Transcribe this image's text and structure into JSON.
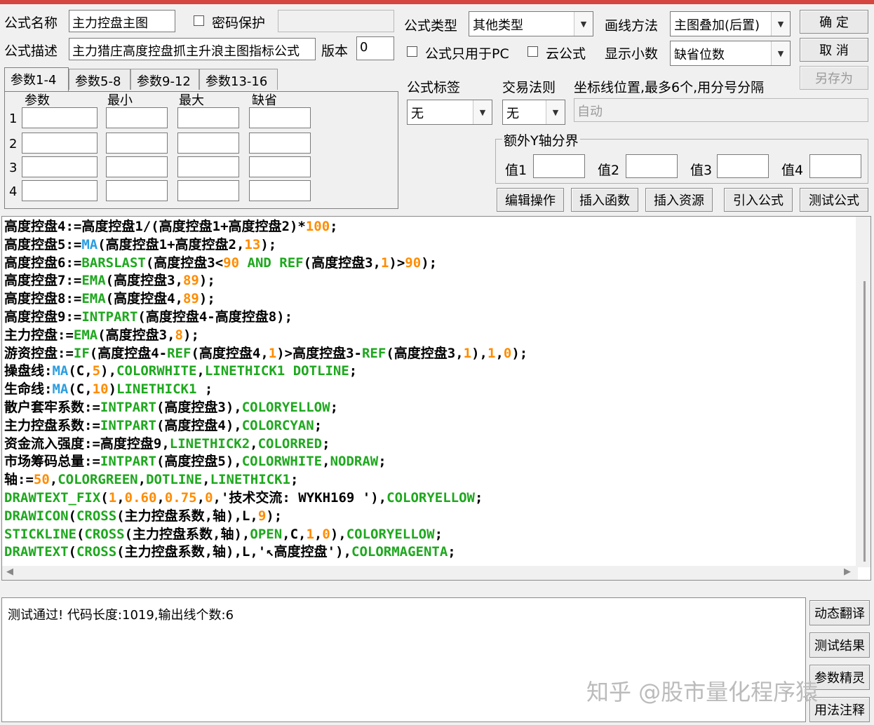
{
  "form": {
    "name_label": "公式名称",
    "name_value": "主力控盘主图",
    "password_label": "密码保护",
    "desc_label": "公式描述",
    "desc_value": "主力猎庄高度控盘抓主升浪主图指标公式",
    "version_label": "版本",
    "version_value": "0",
    "type_label": "公式类型",
    "type_value": "其他类型",
    "draw_label": "画线方法",
    "draw_value": "主图叠加(后置)",
    "pc_only_label": "公式只用于PC",
    "cloud_label": "云公式",
    "decimals_label": "显示小数",
    "decimals_value": "缺省位数"
  },
  "buttons": {
    "ok": "确 定",
    "cancel": "取 消",
    "saveas": "另存为",
    "edit": "编辑操作",
    "insert_func": "插入函数",
    "insert_res": "插入资源",
    "import": "引入公式",
    "test": "测试公式",
    "dynamic": "动态翻译",
    "result": "测试结果",
    "wizard": "参数精灵",
    "notes": "用法注释"
  },
  "tabs": [
    "参数1-4",
    "参数5-8",
    "参数9-12",
    "参数13-16"
  ],
  "params": {
    "headers": [
      "参数",
      "最小",
      "最大",
      "缺省"
    ],
    "rows": [
      "1",
      "2",
      "3",
      "4"
    ]
  },
  "tags": {
    "tag_label": "公式标签",
    "tag_value": "无",
    "rule_label": "交易法则",
    "rule_value": "无",
    "axis_label": "坐标线位置,最多6个,用分号分隔",
    "axis_value": "自动"
  },
  "yaxis": {
    "title": "额外Y轴分界",
    "v1": "值1",
    "v2": "值2",
    "v3": "值3",
    "v4": "值4"
  },
  "colors": {
    "plain": "#000000",
    "func": "#1ea81e",
    "ma": "#2a9ee0",
    "num": "#ff8c00",
    "accent_top": "#d4463f"
  },
  "code_lines": [
    [
      [
        "高度控盘4:=高度控盘1/(高度控盘1+高度控盘2)*",
        "plain"
      ],
      [
        "100",
        "num"
      ],
      [
        ";",
        "plain"
      ]
    ],
    [
      [
        "高度控盘5:=",
        "plain"
      ],
      [
        "MA",
        "ma"
      ],
      [
        "(高度控盘1+高度控盘2,",
        "plain"
      ],
      [
        "13",
        "num"
      ],
      [
        ");",
        "plain"
      ]
    ],
    [
      [
        "高度控盘6:=",
        "plain"
      ],
      [
        "BARSLAST",
        "func"
      ],
      [
        "(高度控盘3<",
        "plain"
      ],
      [
        "90",
        "num"
      ],
      [
        " ",
        "plain"
      ],
      [
        "AND",
        "func"
      ],
      [
        " ",
        "plain"
      ],
      [
        "REF",
        "func"
      ],
      [
        "(高度控盘3,",
        "plain"
      ],
      [
        "1",
        "num"
      ],
      [
        ")>",
        "plain"
      ],
      [
        "90",
        "num"
      ],
      [
        ");",
        "plain"
      ]
    ],
    [
      [
        "高度控盘7:=",
        "plain"
      ],
      [
        "EMA",
        "func"
      ],
      [
        "(高度控盘3,",
        "plain"
      ],
      [
        "89",
        "num"
      ],
      [
        ");",
        "plain"
      ]
    ],
    [
      [
        "高度控盘8:=",
        "plain"
      ],
      [
        "EMA",
        "func"
      ],
      [
        "(高度控盘4,",
        "plain"
      ],
      [
        "89",
        "num"
      ],
      [
        ");",
        "plain"
      ]
    ],
    [
      [
        "高度控盘9:=",
        "plain"
      ],
      [
        "INTPART",
        "func"
      ],
      [
        "(高度控盘4-高度控盘8);",
        "plain"
      ]
    ],
    [
      [
        "主力控盘:=",
        "plain"
      ],
      [
        "EMA",
        "func"
      ],
      [
        "(高度控盘3,",
        "plain"
      ],
      [
        "8",
        "num"
      ],
      [
        ");",
        "plain"
      ]
    ],
    [
      [
        "游资控盘:=",
        "plain"
      ],
      [
        "IF",
        "func"
      ],
      [
        "(高度控盘4-",
        "plain"
      ],
      [
        "REF",
        "func"
      ],
      [
        "(高度控盘4,",
        "plain"
      ],
      [
        "1",
        "num"
      ],
      [
        ")>高度控盘3-",
        "plain"
      ],
      [
        "REF",
        "func"
      ],
      [
        "(高度控盘3,",
        "plain"
      ],
      [
        "1",
        "num"
      ],
      [
        "),",
        "plain"
      ],
      [
        "1",
        "num"
      ],
      [
        ",",
        "plain"
      ],
      [
        "0",
        "num"
      ],
      [
        ");",
        "plain"
      ]
    ],
    [
      [
        "操盘线:",
        "plain"
      ],
      [
        "MA",
        "ma"
      ],
      [
        "(C,",
        "plain"
      ],
      [
        "5",
        "num"
      ],
      [
        "),",
        "plain"
      ],
      [
        "COLORWHITE",
        "func"
      ],
      [
        ",",
        "plain"
      ],
      [
        "LINETHICK1",
        "func"
      ],
      [
        " ",
        "plain"
      ],
      [
        "DOTLINE",
        "func"
      ],
      [
        ";",
        "plain"
      ]
    ],
    [
      [
        "生命线:",
        "plain"
      ],
      [
        "MA",
        "ma"
      ],
      [
        "(C,",
        "plain"
      ],
      [
        "10",
        "num"
      ],
      [
        ")",
        "plain"
      ],
      [
        "LINETHICK1",
        "func"
      ],
      [
        " ;",
        "plain"
      ]
    ],
    [
      [
        "散户套牢系数:=",
        "plain"
      ],
      [
        "INTPART",
        "func"
      ],
      [
        "(高度控盘3),",
        "plain"
      ],
      [
        "COLORYELLOW",
        "func"
      ],
      [
        ";",
        "plain"
      ]
    ],
    [
      [
        "主力控盘系数:=",
        "plain"
      ],
      [
        "INTPART",
        "func"
      ],
      [
        "(高度控盘4),",
        "plain"
      ],
      [
        "COLORCYAN",
        "func"
      ],
      [
        ";",
        "plain"
      ]
    ],
    [
      [
        "资金流入强度:=高度控盘9,",
        "plain"
      ],
      [
        "LINETHICK2",
        "func"
      ],
      [
        ",",
        "plain"
      ],
      [
        "COLORRED",
        "func"
      ],
      [
        ";",
        "plain"
      ]
    ],
    [
      [
        "市场筹码总量:=",
        "plain"
      ],
      [
        "INTPART",
        "func"
      ],
      [
        "(高度控盘5),",
        "plain"
      ],
      [
        "COLORWHITE",
        "func"
      ],
      [
        ",",
        "plain"
      ],
      [
        "NODRAW",
        "func"
      ],
      [
        ";",
        "plain"
      ]
    ],
    [
      [
        "轴:=",
        "plain"
      ],
      [
        "50",
        "num"
      ],
      [
        ",",
        "plain"
      ],
      [
        "COLORGREEN",
        "func"
      ],
      [
        ",",
        "plain"
      ],
      [
        "DOTLINE",
        "func"
      ],
      [
        ",",
        "plain"
      ],
      [
        "LINETHICK1",
        "func"
      ],
      [
        ";",
        "plain"
      ]
    ],
    [
      [
        "DRAWTEXT_FIX",
        "func"
      ],
      [
        "(",
        "plain"
      ],
      [
        "1",
        "num"
      ],
      [
        ",",
        "plain"
      ],
      [
        "0.60",
        "num"
      ],
      [
        ",",
        "plain"
      ],
      [
        "0.75",
        "num"
      ],
      [
        ",",
        "plain"
      ],
      [
        "0",
        "num"
      ],
      [
        ",'技术交流: WYKH169 '),",
        "plain"
      ],
      [
        "COLORYELLOW",
        "func"
      ],
      [
        ";",
        "plain"
      ]
    ],
    [
      [
        "DRAWICON",
        "func"
      ],
      [
        "(",
        "plain"
      ],
      [
        "CROSS",
        "func"
      ],
      [
        "(主力控盘系数,轴),L,",
        "plain"
      ],
      [
        "9",
        "num"
      ],
      [
        ");",
        "plain"
      ]
    ],
    [
      [
        "STICKLINE",
        "func"
      ],
      [
        "(",
        "plain"
      ],
      [
        "CROSS",
        "func"
      ],
      [
        "(主力控盘系数,轴),",
        "plain"
      ],
      [
        "OPEN",
        "func"
      ],
      [
        ",C,",
        "plain"
      ],
      [
        "1",
        "num"
      ],
      [
        ",",
        "plain"
      ],
      [
        "0",
        "num"
      ],
      [
        "),",
        "plain"
      ],
      [
        "COLORYELLOW",
        "func"
      ],
      [
        ";",
        "plain"
      ]
    ],
    [
      [
        "DRAWTEXT",
        "func"
      ],
      [
        "(",
        "plain"
      ],
      [
        "CROSS",
        "func"
      ],
      [
        "(主力控盘系数,轴),L,'↖高度控盘'),",
        "plain"
      ],
      [
        "COLORMAGENTA",
        "func"
      ],
      [
        ";",
        "plain"
      ]
    ]
  ],
  "output": {
    "message": "测试通过! 代码长度:1019,输出线个数:6"
  },
  "watermark": "知乎 @股市量化程序猿"
}
